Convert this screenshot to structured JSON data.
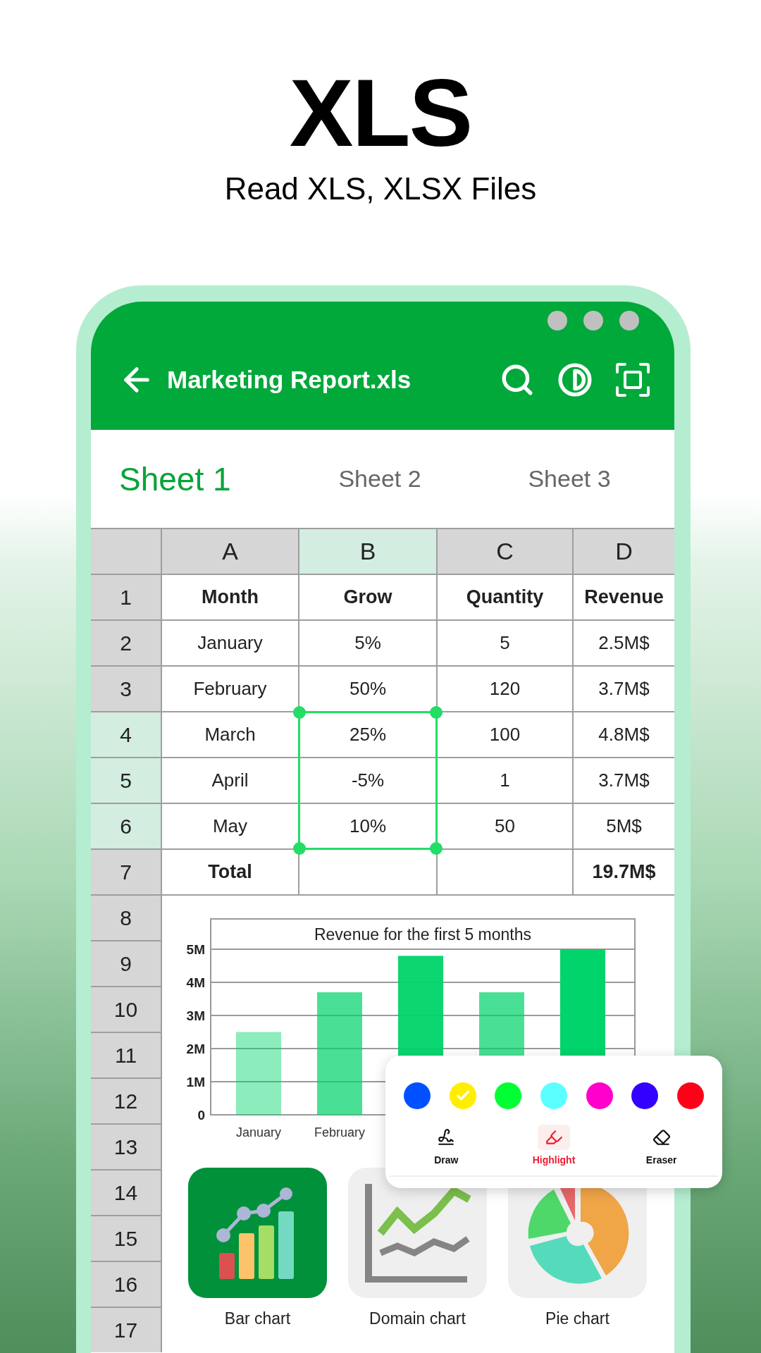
{
  "hero": {
    "title": "XLS",
    "subtitle": "Read XLS, XLSX Files"
  },
  "app_bar": {
    "title": "Marketing Report.xls"
  },
  "tabs": [
    {
      "label": "Sheet 1",
      "selected": true
    },
    {
      "label": "Sheet 2",
      "selected": false
    },
    {
      "label": "Sheet 3",
      "selected": false
    }
  ],
  "sheet": {
    "columns": [
      {
        "label": "A",
        "selected": false
      },
      {
        "label": "B",
        "selected": true
      },
      {
        "label": "C",
        "selected": false
      },
      {
        "label": "D",
        "selected": false
      }
    ],
    "rows": [
      {
        "number": "1",
        "kind": "header",
        "selected": false,
        "cells": [
          "Month",
          "Grow",
          "Quantity",
          "Revenue"
        ]
      },
      {
        "number": "2",
        "kind": "data",
        "selected": false,
        "cells": [
          "January",
          "5%",
          "5",
          "2.5M$"
        ]
      },
      {
        "number": "3",
        "kind": "data",
        "selected": false,
        "cells": [
          "February",
          "50%",
          "120",
          "3.7M$"
        ]
      },
      {
        "number": "4",
        "kind": "data",
        "selected": true,
        "cells": [
          "March",
          "25%",
          "100",
          "4.8M$"
        ]
      },
      {
        "number": "5",
        "kind": "data",
        "selected": true,
        "cells": [
          "April",
          "-5%",
          "1",
          "3.7M$"
        ]
      },
      {
        "number": "6",
        "kind": "data",
        "selected": true,
        "cells": [
          "May",
          "10%",
          "50",
          "5M$"
        ]
      },
      {
        "number": "7",
        "kind": "total",
        "selected": false,
        "cells": [
          "Total",
          null,
          null,
          "19.7M$"
        ]
      }
    ],
    "more_rows": [
      "8",
      "9",
      "10",
      "11",
      "12",
      "13",
      "14",
      "15",
      "16",
      "17"
    ]
  },
  "chart": {
    "chart_data": {
      "type": "bar",
      "title": "Revenue for the first 5 months",
      "categories": [
        "January",
        "February",
        null,
        null,
        null
      ],
      "grid": true,
      "ylim": [
        0,
        5
      ],
      "yticks": [
        {
          "value": 0,
          "label": "0"
        },
        {
          "value": 1,
          "label": "1M"
        },
        {
          "value": 2,
          "label": "2M"
        },
        {
          "value": 3,
          "label": "3M"
        },
        {
          "value": 4,
          "label": "4M"
        },
        {
          "value": 5,
          "label": "5M"
        }
      ],
      "series": [
        {
          "color": "#00d46a",
          "values": [
            2.5,
            3.7,
            4.8,
            3.7,
            5
          ]
        }
      ]
    }
  },
  "chart_types": [
    {
      "label": "Bar chart",
      "kind": "bar",
      "selected": true
    },
    {
      "label": "Domain chart",
      "kind": "line",
      "selected": false
    },
    {
      "label": "Pie chart",
      "kind": "pie",
      "selected": false
    }
  ],
  "palette": {
    "colors": [
      {
        "color": "#0050ff",
        "selected": false
      },
      {
        "color": "#ffee00",
        "selected": true
      },
      {
        "color": "#00ff33",
        "selected": false
      },
      {
        "color": "#5cffff",
        "selected": false
      },
      {
        "color": "#ff00cc",
        "selected": false
      },
      {
        "color": "#3300ff",
        "selected": false
      },
      {
        "color": "#ff0019",
        "selected": false
      }
    ],
    "tools": [
      {
        "label": "Draw",
        "kind": "draw",
        "selected": false
      },
      {
        "label": "Highlight",
        "kind": "highlight",
        "selected": true
      },
      {
        "label": "Eraser",
        "kind": "eraser",
        "selected": false
      }
    ]
  }
}
